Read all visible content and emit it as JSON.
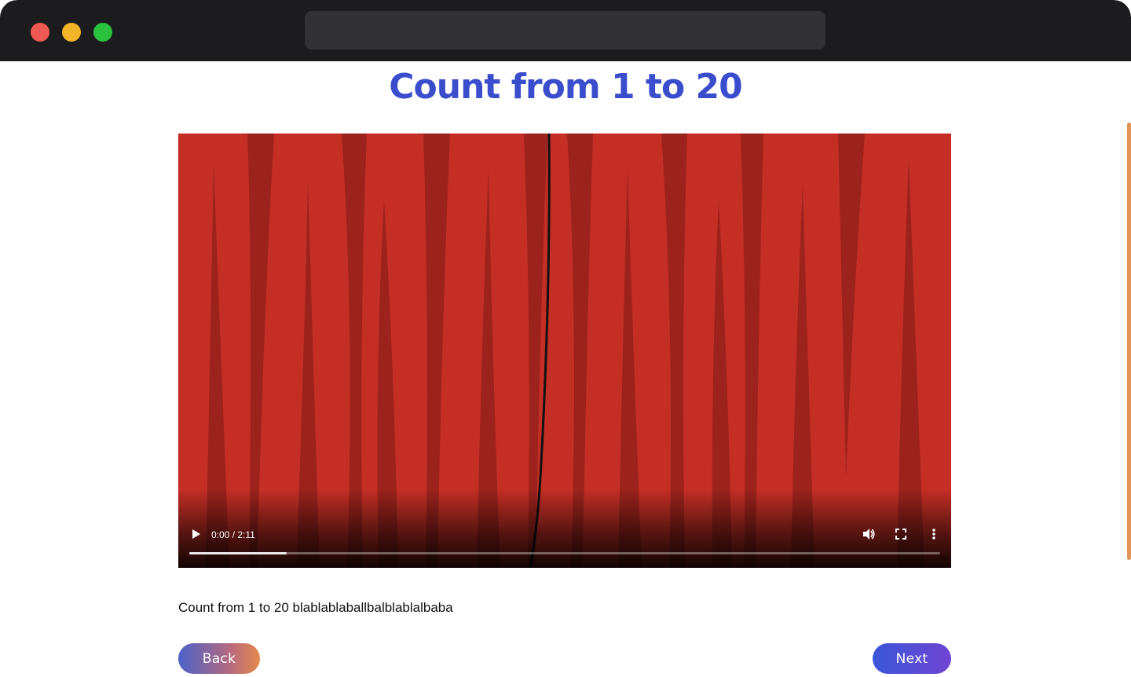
{
  "page": {
    "title": "Count from 1 to 20",
    "description": "Count from 1 to 20 blablablaballbalblablalbaba"
  },
  "video": {
    "time_display": "0:00 / 2:11",
    "progress_fraction": 0.13,
    "icons": [
      "play-icon",
      "volume-icon",
      "fullscreen-icon",
      "more-vert-icon"
    ]
  },
  "navigation": {
    "back_label": "Back",
    "next_label": "Next"
  },
  "colors": {
    "title": "#3a4dcc",
    "curtain": "#c42e25",
    "scrollbar": "#e59457"
  }
}
